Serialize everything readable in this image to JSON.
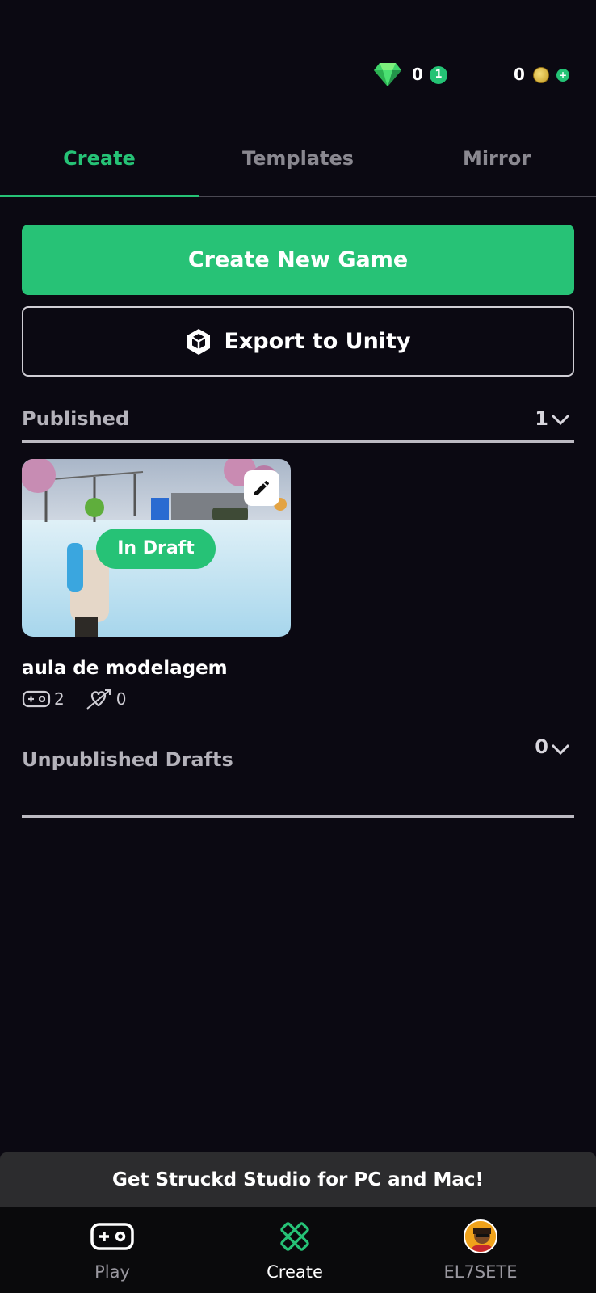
{
  "header": {
    "gems": "0",
    "gem_badge": "1",
    "coins": "0",
    "coin_plus": "+"
  },
  "tabs": [
    {
      "label": "Create",
      "active": true
    },
    {
      "label": "Templates",
      "active": false
    },
    {
      "label": "Mirror",
      "active": false
    }
  ],
  "actions": {
    "create_label": "Create New Game",
    "export_label": "Export to Unity"
  },
  "published": {
    "title": "Published",
    "count": "1",
    "games": [
      {
        "status_badge": "In Draft",
        "title": "aula de modelagem",
        "plays": "2",
        "likes": "0"
      }
    ]
  },
  "drafts": {
    "title": "Unpublished Drafts",
    "count": "0"
  },
  "promo": "Get Struckd Studio for PC and Mac!",
  "bottom_nav": [
    {
      "label": "Play",
      "icon": "gamepad-icon",
      "active": false
    },
    {
      "label": "Create",
      "icon": "pencil-ruler-icon",
      "active": true
    },
    {
      "label": "EL7SETE",
      "icon": "avatar",
      "active": false
    }
  ],
  "colors": {
    "accent": "#26c276",
    "background": "#0b0912"
  }
}
